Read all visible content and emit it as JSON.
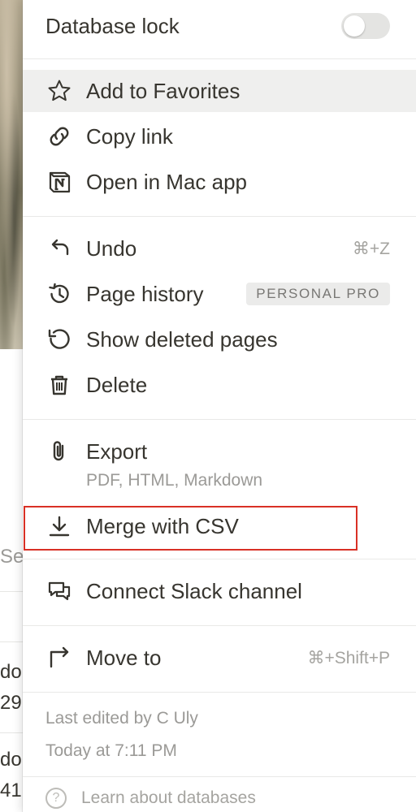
{
  "background": {
    "cells": [
      "Se",
      "do",
      "29",
      "do",
      "41"
    ]
  },
  "menu": {
    "database_lock": {
      "label": "Database lock",
      "enabled": false
    },
    "group1": [
      {
        "label": "Add to Favorites",
        "icon": "star-icon"
      },
      {
        "label": "Copy link",
        "icon": "link-icon"
      },
      {
        "label": "Open in Mac app",
        "icon": "notion-app-icon"
      }
    ],
    "group2": [
      {
        "label": "Undo",
        "icon": "undo-icon",
        "shortcut": "⌘+Z"
      },
      {
        "label": "Page history",
        "icon": "history-icon",
        "badge": "PERSONAL PRO"
      },
      {
        "label": "Show deleted pages",
        "icon": "restore-icon"
      },
      {
        "label": "Delete",
        "icon": "trash-icon"
      }
    ],
    "export": {
      "label": "Export",
      "icon": "paperclip-icon",
      "subtitle": "PDF, HTML, Markdown"
    },
    "merge_csv": {
      "label": "Merge with CSV",
      "icon": "download-icon"
    },
    "connect_slack": {
      "label": "Connect Slack channel",
      "icon": "chat-bubbles-icon"
    },
    "move_to": {
      "label": "Move to",
      "icon": "arrow-turn-right-icon",
      "shortcut": "⌘+Shift+P"
    },
    "footer": {
      "last_edited": "Last edited by C Uly",
      "timestamp": "Today at 7:11 PM",
      "learn": "Learn about databases",
      "learn_icon": "?"
    }
  },
  "colors": {
    "text": "#37352f",
    "muted": "#9b9a97",
    "hover": "#efefee",
    "highlight": "#d93025"
  }
}
